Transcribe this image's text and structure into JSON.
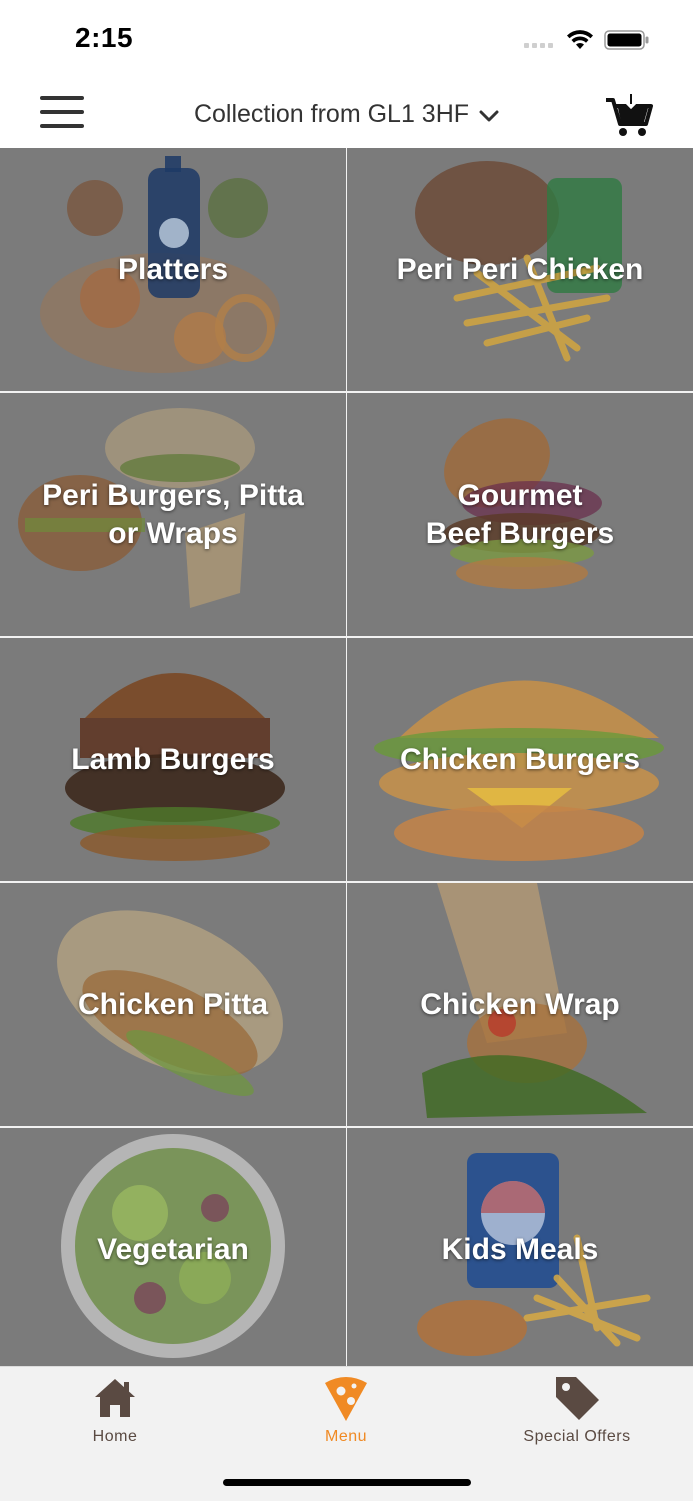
{
  "status": {
    "time": "2:15"
  },
  "header": {
    "location": "Collection from GL1 3HF"
  },
  "categories": [
    {
      "label": "Platters"
    },
    {
      "label": "Peri Peri Chicken"
    },
    {
      "label": "Peri Burgers, Pitta\nor Wraps"
    },
    {
      "label": "Gourmet\nBeef Burgers"
    },
    {
      "label": "Lamb Burgers"
    },
    {
      "label": "Chicken Burgers"
    },
    {
      "label": "Chicken Pitta"
    },
    {
      "label": "Chicken Wrap"
    },
    {
      "label": "Vegetarian"
    },
    {
      "label": "Kids Meals"
    }
  ],
  "tabs": [
    {
      "label": "Home",
      "icon": "home-icon",
      "color": "#5a4a42"
    },
    {
      "label": "Menu",
      "icon": "pizza-slice-icon",
      "color": "#f08a24"
    },
    {
      "label": "Special Offers",
      "icon": "tag-icon",
      "color": "#5a4a42"
    }
  ],
  "colors": {
    "accent": "#f08a24",
    "icon_dark": "#5a4a42",
    "tile_overlay": "#7b7b7b"
  }
}
